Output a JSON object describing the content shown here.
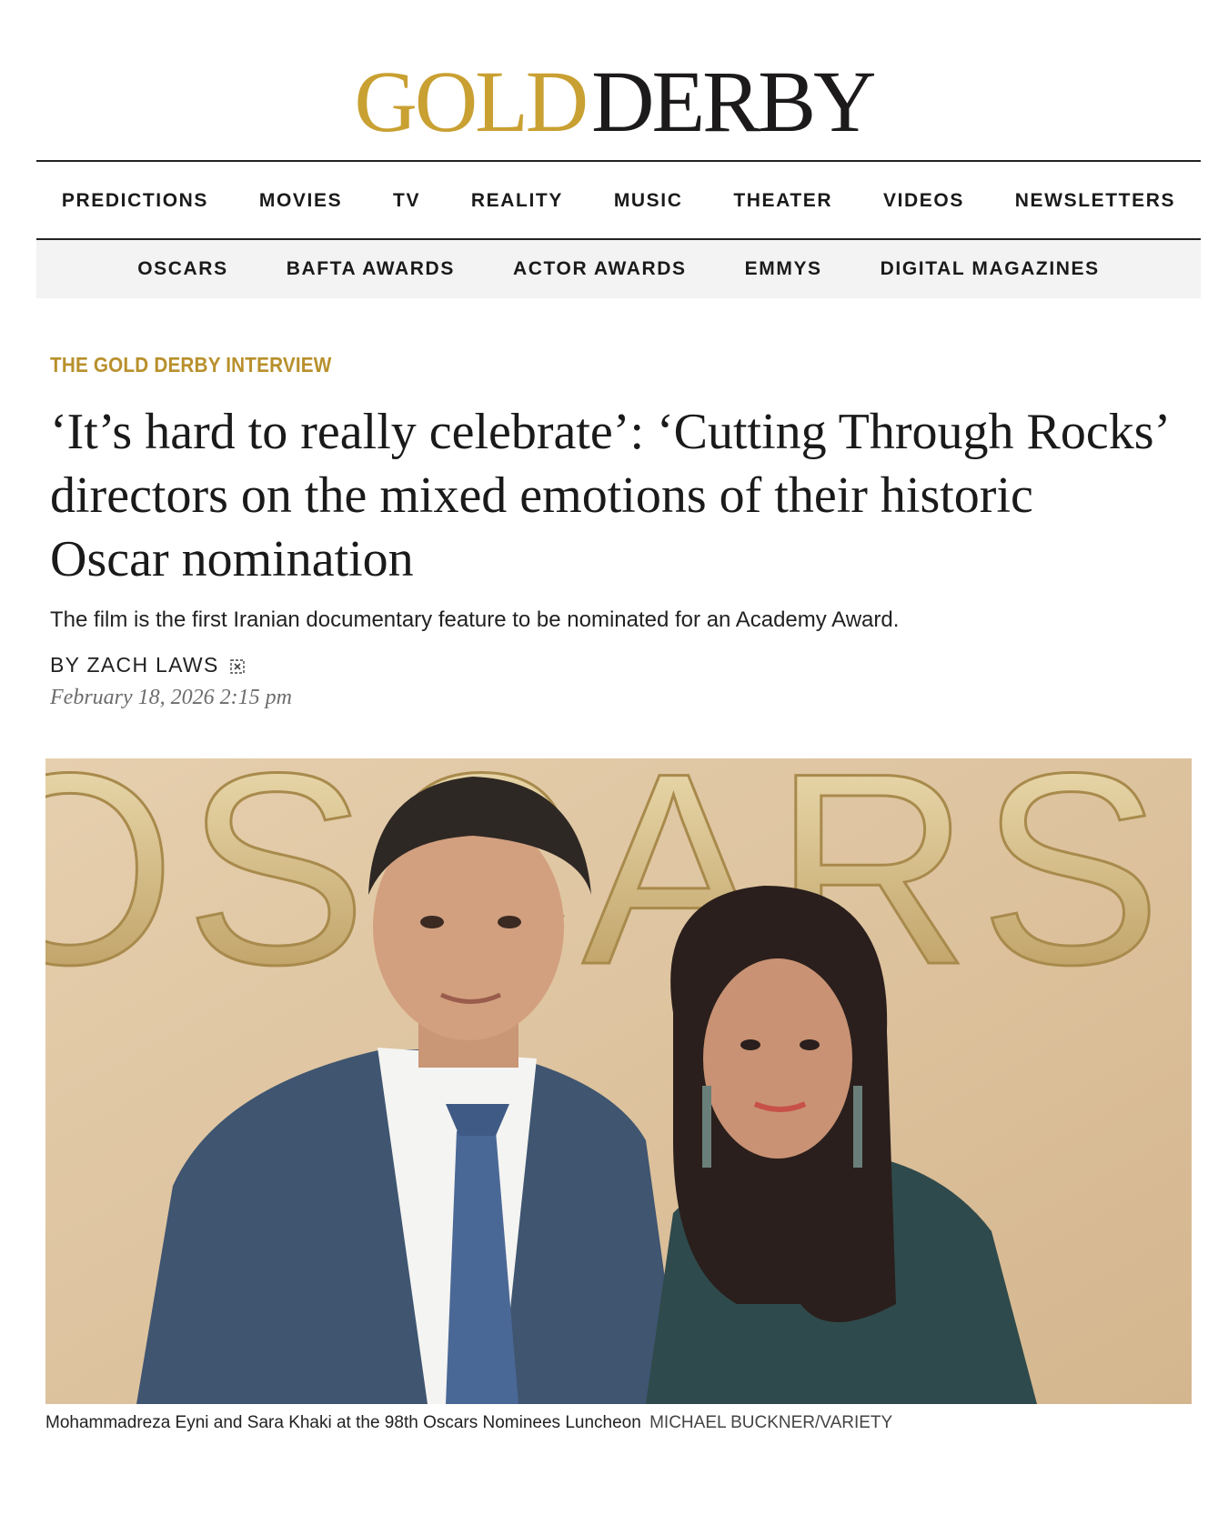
{
  "logo": {
    "gold_text": "GOLD",
    "dark_text": "DERBY",
    "colors": {
      "gold": "#c9a032",
      "dark": "#1c1a1a"
    }
  },
  "primary_nav": [
    "PREDICTIONS",
    "MOVIES",
    "TV",
    "REALITY",
    "MUSIC",
    "THEATER",
    "VIDEOS",
    "NEWSLETTERS"
  ],
  "secondary_nav": [
    "OSCARS",
    "BAFTA AWARDS",
    "ACTOR AWARDS",
    "EMMYS",
    "DIGITAL MAGAZINES"
  ],
  "article": {
    "kicker": "THE GOLD DERBY INTERVIEW",
    "headline_lines": [
      "‘It’s hard to really celebrate’: ‘Cutting Through Rocks’",
      "directors on the mixed emotions of their historic",
      "Oscar nomination"
    ],
    "dek": "The film is the first Iranian documentary feature to be nominated for an Academy Award.",
    "byline": "BY ZACH LAWS",
    "author_icon": "share-icon",
    "date": "February 18, 2026 2:15 pm",
    "photo": {
      "backdrop_text": "OSCARS",
      "caption": "Mohammadreza Eyni and Sara Khaki at the 98th Oscars Nominees Luncheon",
      "credit": "MICHAEL BUCKNER/VARIETY"
    }
  },
  "colors": {
    "kicker": "#b8902c",
    "subnav_bg": "#f3f3f3",
    "photo_backdrop": "#dcc3a0"
  }
}
